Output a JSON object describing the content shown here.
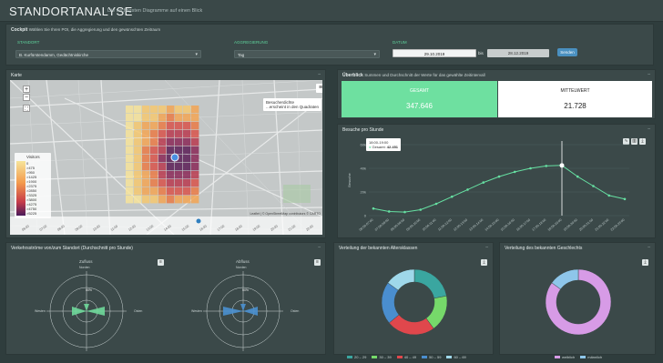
{
  "header": {
    "title": "STANDORTANALYSE",
    "subtitle": "Die wichtigsten Diagramme auf einen Blick"
  },
  "cockpit": {
    "title": "Cockpit",
    "hint": "Wählen Sie Ihren POI, die Aggregierung und den gewünschten Zeitraum",
    "standort_label": "STANDORT",
    "standort_value": "B. Kurfürstendamm, Gedächtniskirche",
    "aggregation_label": "AGGREGIERUNG",
    "aggregation_value": "Tag",
    "datum_label": "DATUM",
    "date_from": "29.10.2019",
    "date_sep": "bis",
    "date_to": "28.12.2019",
    "submit_label": "Senden"
  },
  "map": {
    "title": "Karte",
    "zoom_in": "+",
    "zoom_out": "−",
    "tooltip_line1": "Besucherdichte",
    "tooltip_line2": "...erscheint in den Quadraten",
    "legend_title": "Visitors",
    "legend_items": [
      "0",
      ">475",
      ">950",
      ">1425",
      ">1900",
      ">2375",
      ">2850",
      ">3325",
      ">3800",
      ">4275",
      ">4750",
      ">5225"
    ],
    "attribution": "Leaflet | © OpenStreetMap contributors © CARTO",
    "timeline_labels": [
      "06:00",
      "07:00",
      "08:00",
      "09:00",
      "10:00",
      "11:00",
      "12:00",
      "13:00",
      "14:00",
      "15:00",
      "16:00",
      "17:00",
      "18:00",
      "19:00",
      "20:00",
      "21:00",
      "22:00"
    ]
  },
  "overview": {
    "title": "Überblick",
    "hint": "Summen und Durchschnitt der Werte für das gewählte Zeitintervall",
    "gesamt_label": "GESAMT",
    "gesamt_value": "347.646",
    "mittel_label": "MITTELWERT",
    "mittel_value": "21.728"
  },
  "hourly": {
    "title": "Besuche pro Stunde",
    "tooltip_time": "18:00-19:00",
    "tooltip_label": "Gesamt:",
    "tooltip_value": "42.451"
  },
  "chart_data": {
    "type": "line",
    "title": "Besuche pro Stunde",
    "xlabel": "",
    "ylabel": "Besuche",
    "ylim": [
      0,
      60000
    ],
    "yticks": [
      "0",
      "20k",
      "40k",
      "60k"
    ],
    "categories": [
      "06:00-07:00",
      "07:00-08:00",
      "08:00-09:00",
      "09:00-10:00",
      "10:00-11:00",
      "11:00-12:00",
      "12:00-13:00",
      "13:00-14:00",
      "14:00-15:00",
      "15:00-16:00",
      "16:00-17:00",
      "17:00-18:00",
      "18:00-19:00",
      "19:00-20:00",
      "20:00-21:00",
      "21:00-22:00",
      "22:00-23:00"
    ],
    "values": [
      6000,
      3500,
      3000,
      5000,
      10000,
      16000,
      22000,
      28000,
      33000,
      37000,
      40000,
      42000,
      42451,
      33000,
      25000,
      17000,
      14000
    ],
    "grid": true,
    "legend": "none"
  },
  "traffic": {
    "title": "Verkehrsströme von/zum Standort (Durchschnitt pro Stunde)",
    "zufluss_label": "Zufluss",
    "abfluss_label": "Abfluss",
    "norden": "Norden",
    "sueden": "Süden",
    "westen": "Westen",
    "osten": "Osten",
    "zufluss_ring": "50%",
    "abfluss_ring": "50%"
  },
  "age": {
    "title": "Verteilung der bekannten Altersklassen",
    "legend": [
      {
        "label": "20 – 29",
        "color": "#3aa6a0"
      },
      {
        "label": "30 – 39",
        "color": "#76d96a"
      },
      {
        "label": "40 – 49",
        "color": "#e0474c"
      },
      {
        "label": "50 – 59",
        "color": "#4a8ecf"
      },
      {
        "label": "60 – 69",
        "color": "#9fd8ea"
      }
    ],
    "values": [
      22,
      18,
      24,
      21,
      15
    ]
  },
  "gender": {
    "title": "Verteilung des bekannten Geschlechts",
    "legend": [
      {
        "label": "weiblich",
        "color": "#d79be6"
      },
      {
        "label": "männlich",
        "color": "#8ec6ea"
      }
    ],
    "values": [
      85,
      15
    ]
  },
  "colors": {
    "accent_green": "#5fd39c",
    "kpi_bg": "#6ee0a0",
    "line": "#66e0a2"
  }
}
